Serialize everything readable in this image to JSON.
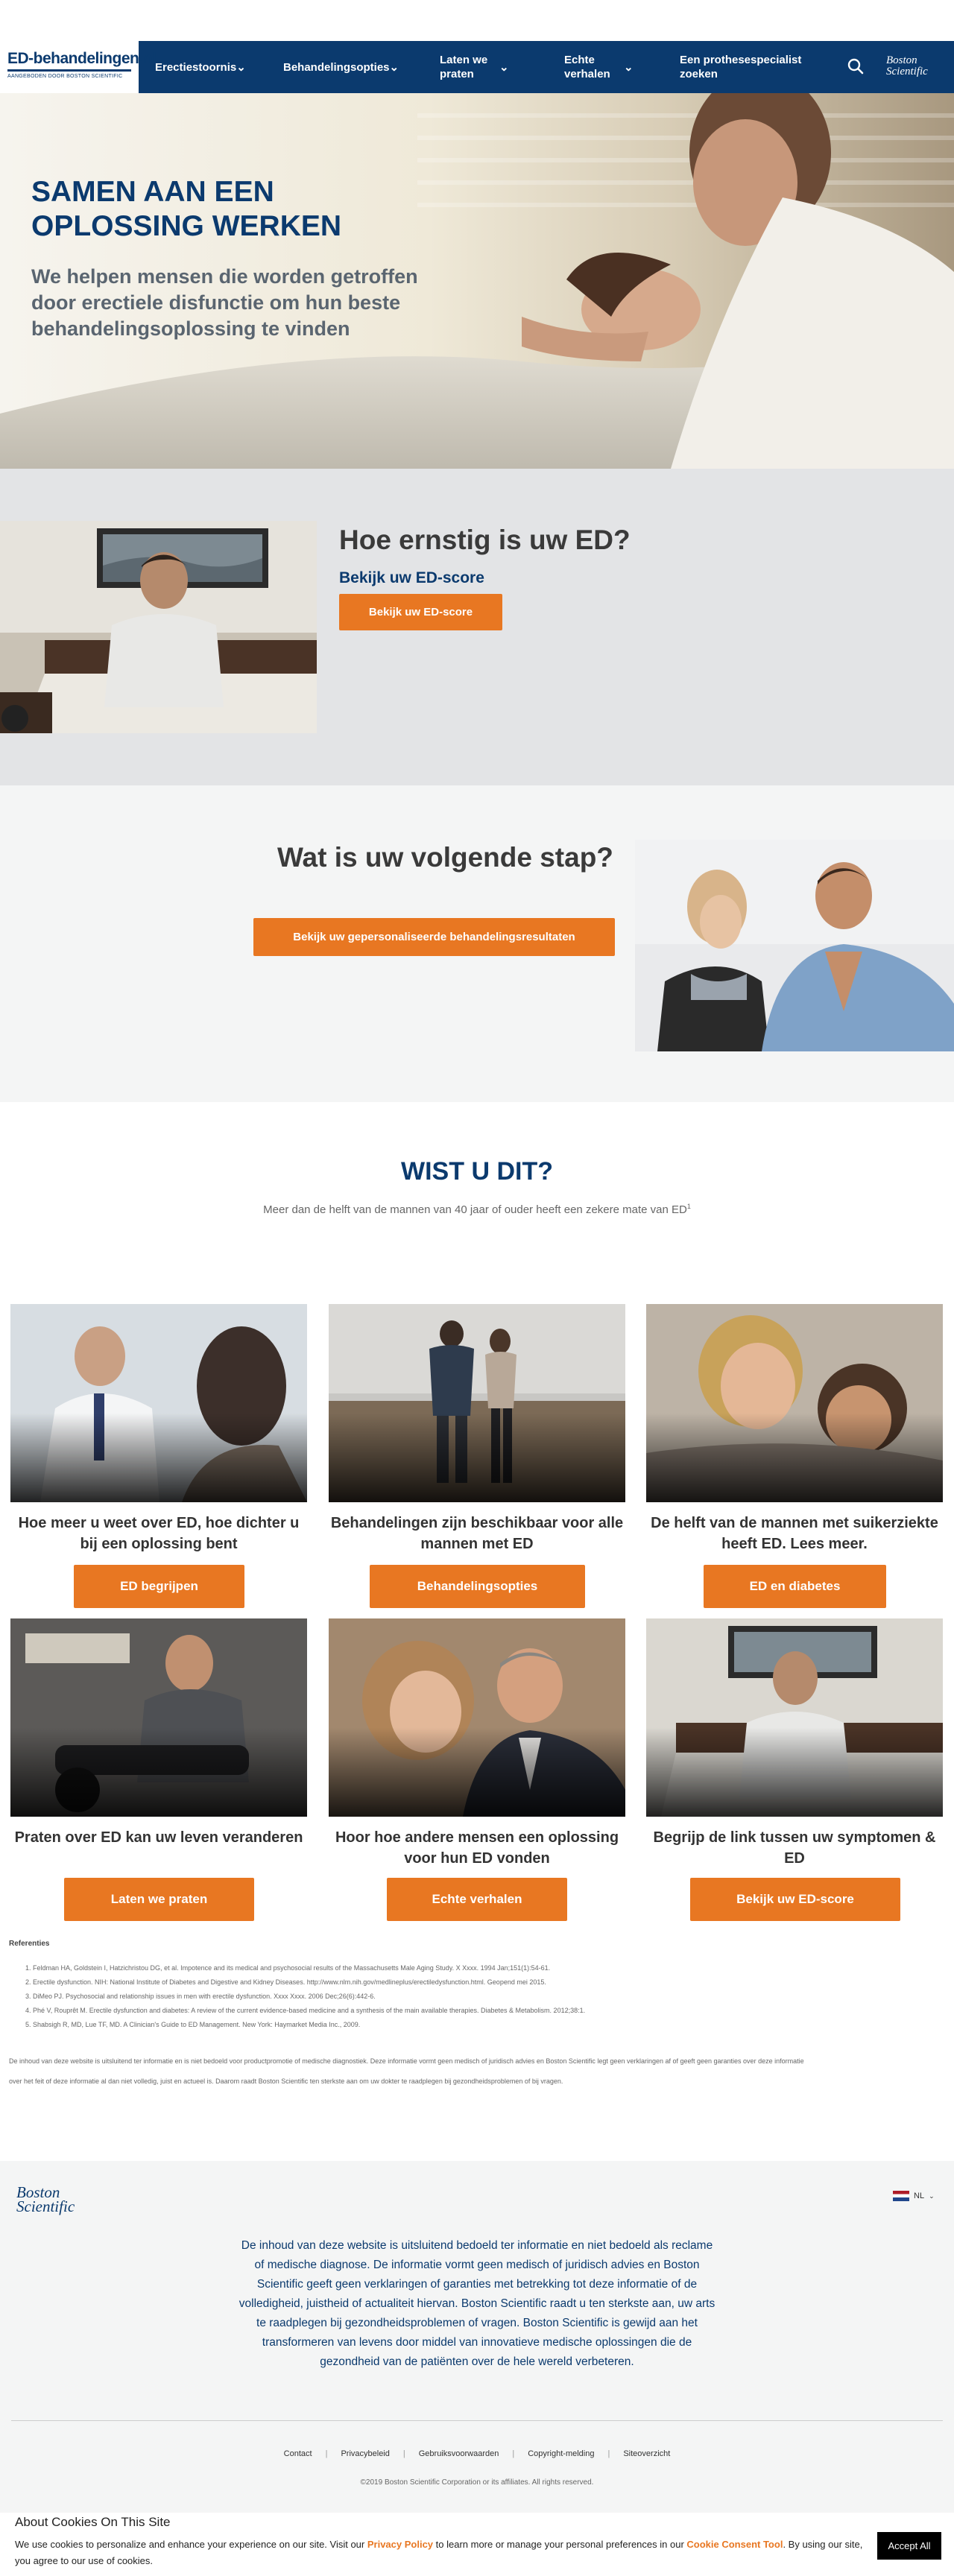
{
  "header": {
    "logo_text": "ED-behandelingen.nl",
    "logo_tagline": "AANGEBODEN DOOR BOSTON SCIENTIFIC",
    "nav": [
      {
        "label": "Erectiestoornis"
      },
      {
        "label": "Behandelingsopties"
      },
      {
        "label": "Laten we praten"
      },
      {
        "label": "Echte verhalen"
      },
      {
        "label": "Een prothesespecialist zoeken"
      }
    ],
    "brand_line1": "Boston",
    "brand_line2": "Scientific"
  },
  "hero": {
    "title": "SAMEN AAN EEN OPLOSSING WERKEN",
    "subtitle": "We helpen mensen die worden getroffen door erectiele disfunctie om hun beste behandelingsoplossing te vinden"
  },
  "score_section": {
    "title": "Hoe ernstig is uw ED?",
    "subtitle": "Bekijk uw ED-score",
    "button": "Bekijk uw ED-score"
  },
  "next_step": {
    "title": "Wat is uw volgende stap?",
    "button": "Bekijk uw gepersonaliseerde behandelingsresultaten"
  },
  "did_you_know": {
    "title": "WIST U DIT?",
    "text": "Meer dan de helft van de mannen van 40 jaar of ouder heeft een zekere mate van ED",
    "sup": "1"
  },
  "cards": [
    {
      "title": "Hoe meer u weet over ED, hoe dichter u bij een oplossing bent",
      "button": "ED begrijpen"
    },
    {
      "title": "Behandelingen zijn beschikbaar voor alle mannen met ED",
      "button": "Behandelingsopties"
    },
    {
      "title": "De helft van de mannen met suikerziekte heeft ED. Lees meer.",
      "button": "ED en diabetes"
    },
    {
      "title": "Praten over ED kan uw leven veranderen",
      "button": "Laten we praten"
    },
    {
      "title": "Hoor hoe andere mensen een oplossing voor hun ED vonden",
      "button": "Echte verhalen"
    },
    {
      "title": "Begrijp de link tussen uw symptomen & ED",
      "button": "Bekijk uw ED-score"
    }
  ],
  "references": {
    "title": "Referenties",
    "items": [
      "Feldman HA, Goldstein I, Hatzichristou DG, et al. Impotence and its medical and psychosocial results of the Massachusetts Male Aging Study. X Xxxx. 1994 Jan;151(1):54-61.",
      "Erectile dysfunction. NIH: National Institute of Diabetes and Digestive and Kidney Diseases. http://www.nlm.nih.gov/medlineplus/erectiledysfunction.html. Geopend mei 2015.",
      "DiMeo PJ. Psychosocial and relationship issues in men with erectile dysfunction. Xxxx Xxxx. 2006 Dec;26(6):442-6.",
      "Phé V, Rouprêt M. Erectile dysfunction and diabetes: A review of the current evidence-based medicine and a synthesis of the main available therapies. Diabetes & Metabolism. 2012;38:1.",
      "Shabsigh R, MD, Lue TF, MD. A Clinician's Guide to ED Management. New York: Haymarket Media Inc., 2009."
    ],
    "disclaimer_line1": "De inhoud van deze website is uitsluitend ter informatie en is niet bedoeld voor productpromotie of medische diagnostiek. Deze informatie vormt geen medisch of juridisch advies en Boston Scientific legt geen verklaringen af of geeft geen garanties over deze informatie",
    "disclaimer_line2": "over het feit of deze informatie al dan niet volledig, juist en actueel is. Daarom raadt Boston Scientific ten sterkste aan om uw dokter te raadplegen bij gezondheidsproblemen of bij vragen."
  },
  "footer": {
    "brand_line1": "Boston",
    "brand_line2": "Scientific",
    "language": "NL",
    "text": "De inhoud van deze website is uitsluitend bedoeld ter informatie en niet bedoeld als reclame of medische diagnose. De informatie vormt geen medisch of juridisch advies en Boston Scientific geeft geen verklaringen of garanties met betrekking tot deze informatie of de volledigheid, juistheid of actualiteit hiervan. Boston Scientific raadt u ten sterkste aan, uw arts te raadplegen bij gezondheidsproblemen of vragen. Boston Scientific is gewijd aan het transformeren van levens door middel van innovatieve medische oplossingen die de gezondheid van de patiënten over de hele wereld verbeteren.",
    "links": [
      "Contact",
      "Privacybeleid",
      "Gebruiksvoorwaarden",
      "Copyright-melding",
      "Siteoverzicht"
    ],
    "copyright": "©2019 Boston Scientific Corporation or its affiliates. All rights reserved."
  },
  "cookie": {
    "title": "About Cookies On This Site",
    "text_before": "We use cookies to personalize and enhance your experience on our site. Visit our ",
    "privacy_link": "Privacy Policy",
    "text_middle": " to learn more or manage your personal preferences in our ",
    "consent_link": "Cookie Consent Tool",
    "text_after": ". By using our site, you agree to our use of cookies.",
    "accept": "Accept All"
  },
  "colors": {
    "navy": "#0b3a6e",
    "orange": "#e87722",
    "gray_band": "#e3e4e6",
    "light_band": "#f4f5f5"
  }
}
